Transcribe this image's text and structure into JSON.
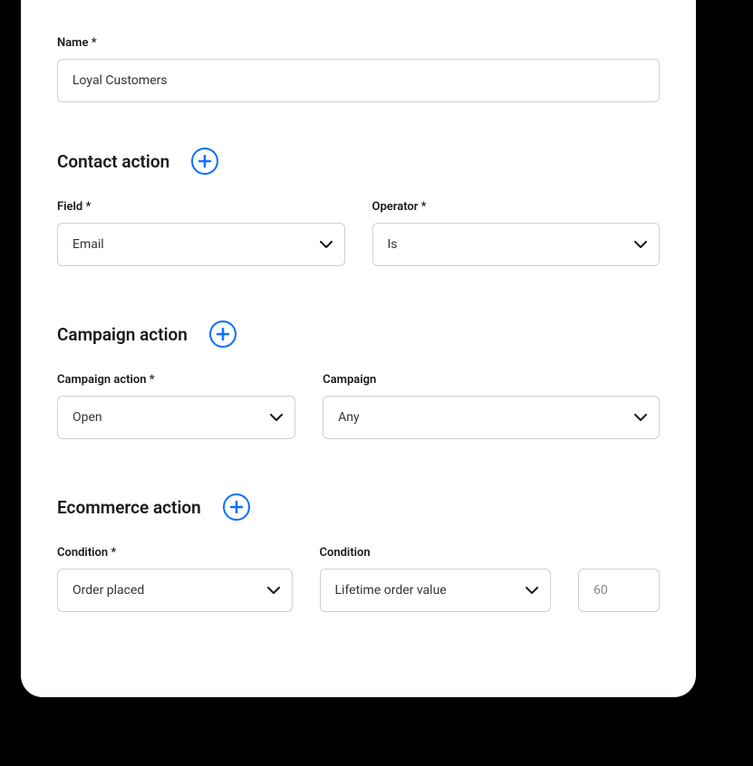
{
  "name": {
    "label": "Name *",
    "value": "Loyal Customers"
  },
  "contact_action": {
    "title": "Contact action",
    "field_label": "Field *",
    "field_value": "Email",
    "operator_label": "Operator *",
    "operator_value": "Is"
  },
  "campaign_action": {
    "title": "Campaign action",
    "action_label": "Campaign action *",
    "action_value": "Open",
    "campaign_label": "Campaign",
    "campaign_value": "Any"
  },
  "ecommerce_action": {
    "title": "Ecommerce action",
    "condition1_label": "Condition *",
    "condition1_value": "Order placed",
    "condition2_label": "Condition",
    "condition2_value": "Lifetime order value",
    "number_value": "60"
  }
}
